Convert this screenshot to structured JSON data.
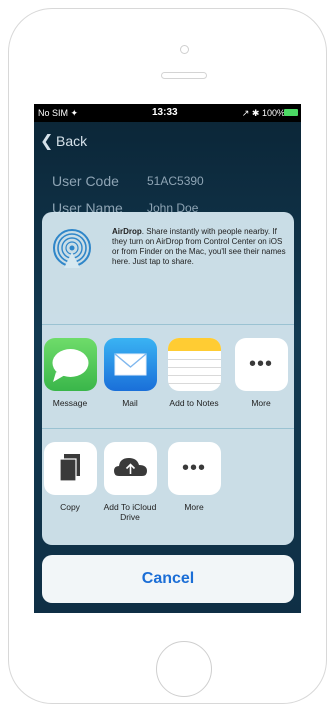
{
  "status_bar": {
    "carrier": "No SIM ✦",
    "time": "13:33",
    "right": "↗ ✱ 100%"
  },
  "nav": {
    "back_label": "Back"
  },
  "fields": [
    {
      "label": "User Code",
      "value": "51AC5390"
    },
    {
      "label": "User Name",
      "value": "John Doe"
    }
  ],
  "airdrop": {
    "title": "AirDrop",
    "description": ". Share instantly with people nearby. If they turn on AirDrop from Control Center on iOS or from Finder on the Mac, you'll see their names here. Just tap to share."
  },
  "share_apps": [
    {
      "label": "Message",
      "icon": "message-icon"
    },
    {
      "label": "Mail",
      "icon": "mail-icon"
    },
    {
      "label": "Add to Notes",
      "icon": "notes-icon"
    },
    {
      "label": "More",
      "icon": "more-icon"
    }
  ],
  "actions": [
    {
      "label": "Copy",
      "icon": "copy-icon"
    },
    {
      "label": "Add To iCloud Drive",
      "icon": "icloud-upload-icon"
    },
    {
      "label": "More",
      "icon": "more-icon"
    }
  ],
  "cancel_label": "Cancel",
  "colors": {
    "accent": "#1b6ed6",
    "battery": "#4cd964"
  }
}
